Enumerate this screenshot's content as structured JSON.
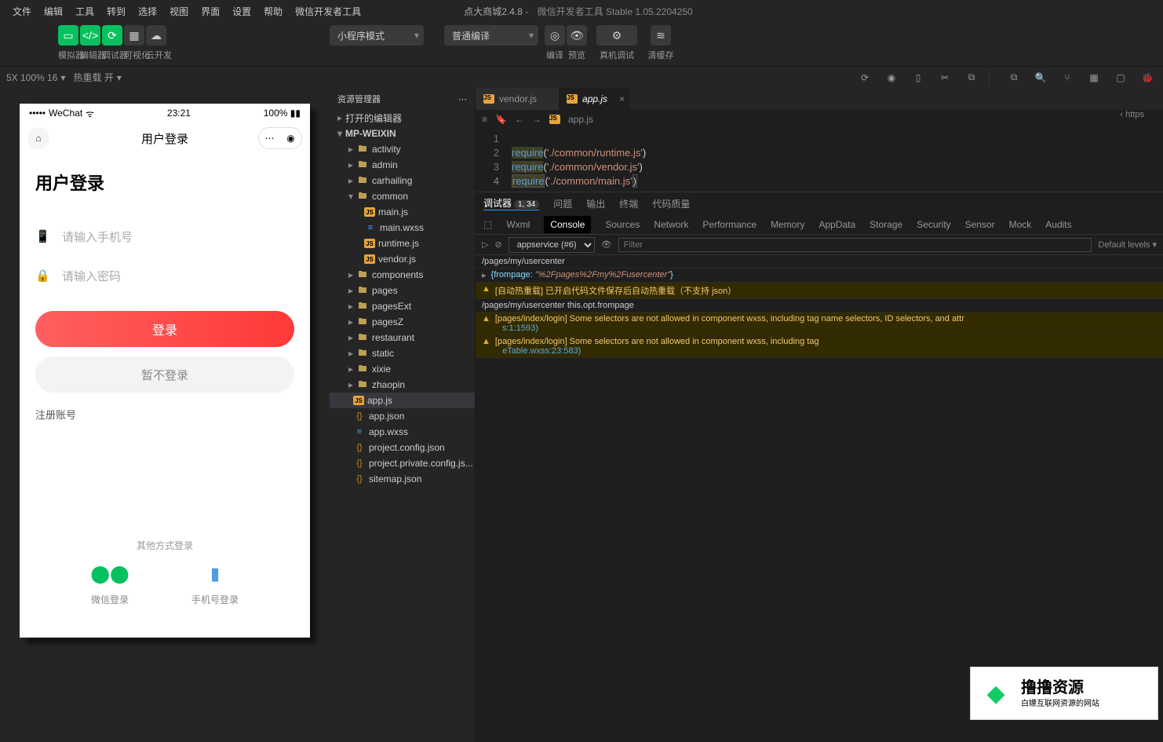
{
  "menubar": [
    "文件",
    "编辑",
    "工具",
    "转到",
    "选择",
    "视图",
    "界面",
    "设置",
    "帮助",
    "微信开发者工具"
  ],
  "title": {
    "project": "点大商城2.4.8",
    "app": "微信开发者工具 Stable 1.05.2204250"
  },
  "toolbar": {
    "labels": [
      "模拟器",
      "编辑器",
      "调试器",
      "可视化",
      "云开发"
    ],
    "mode_dd": "小程序模式",
    "compile_dd": "普通编译",
    "actions": [
      "编译",
      "预览",
      "真机调试",
      "清缓存"
    ]
  },
  "toolbar2": {
    "zoom": "5X 100% 16",
    "reload": "热重载 开"
  },
  "phone": {
    "wechat": "WeChat",
    "time": "23:21",
    "battery": "100%",
    "page_title": "用户登录",
    "h1": "用户登录",
    "ph_phone": "请输入手机号",
    "ph_pwd": "请输入密码",
    "btn_login": "登录",
    "btn_skip": "暂不登录",
    "reg": "注册账号",
    "other_label": "其他方式登录",
    "opt_wechat": "微信登录",
    "opt_phone": "手机号登录"
  },
  "explorer": {
    "title": "资源管理器",
    "open_editors": "打开的编辑器",
    "root": "MP-WEIXIN",
    "folders": [
      "activity",
      "admin",
      "carhailing",
      "common",
      "components",
      "pages",
      "pagesExt",
      "pagesZ",
      "restaurant",
      "static",
      "xixie",
      "zhaopin"
    ],
    "common_files": [
      "main.js",
      "main.wxss",
      "runtime.js",
      "vendor.js"
    ],
    "root_files": [
      "app.js",
      "app.json",
      "app.wxss",
      "project.config.json",
      "project.private.config.js...",
      "sitemap.json"
    ]
  },
  "editor": {
    "tabs": [
      {
        "name": "vendor.js"
      },
      {
        "name": "app.js"
      }
    ],
    "breadcrumb": "app.js",
    "lines": [
      {
        "n": "1",
        "req": "",
        "str": "",
        "rest": ""
      },
      {
        "n": "2",
        "req": "require",
        "str": "'./common/runtime.js'"
      },
      {
        "n": "3",
        "req": "require",
        "str": "'./common/vendor.js'"
      },
      {
        "n": "4",
        "req": "require",
        "str": "'./common/main.js'"
      }
    ],
    "outline": "https"
  },
  "panel": {
    "tabs": [
      "调试器",
      "问题",
      "输出",
      "终端",
      "代码质量"
    ],
    "debugger_badge": "1, 34",
    "devtabs": [
      "Wxml",
      "Console",
      "Sources",
      "Network",
      "Performance",
      "Memory",
      "AppData",
      "Storage",
      "Security",
      "Sensor",
      "Mock",
      "Audits"
    ],
    "ctx": "appservice (#6)",
    "filter_ph": "Filter",
    "levels": "Default levels",
    "lines": [
      {
        "t": "path",
        "v": "/pages/my/usercenter"
      },
      {
        "t": "obj",
        "v": "{frompage: \"%2Fpages%2Fmy%2Fusercenter\"}"
      },
      {
        "t": "warn",
        "v": "[自动热重载] 已开启代码文件保存后自动热重载（不支持 json）"
      },
      {
        "t": "path",
        "v": "/pages/my/usercenter this.opt.frompage"
      },
      {
        "t": "warn",
        "v": "[pages/index/login] Some selectors are not allowed in component wxss, including tag name selectors, ID selectors, and attr",
        "link": "s:1:1593)"
      },
      {
        "t": "warn",
        "v": "[pages/index/login] Some selectors are not allowed in component wxss, including tag",
        "link": "eTable.wxss:23:583)"
      }
    ]
  },
  "watermark": {
    "big": "撸撸资源",
    "small": "白嫖互联网资源的网站"
  }
}
